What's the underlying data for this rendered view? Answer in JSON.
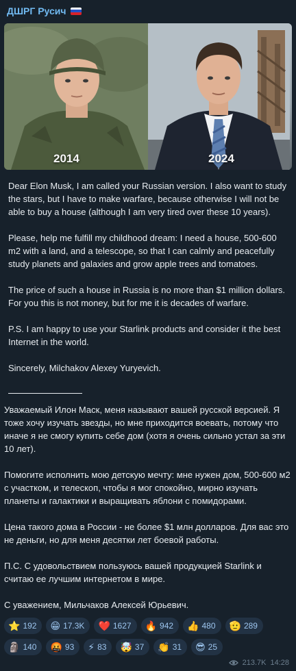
{
  "channel": {
    "name": "ДШРГ Русич"
  },
  "photo": {
    "year_left": "2014",
    "year_right": "2024"
  },
  "english": {
    "p1": "Dear Elon Musk, I am called your Russian version. I also want to study the stars, but I have to make warfare, because otherwise I will not be able to buy a house (although I am very tired over these 10 years).",
    "p2": "Please, help me fulfill my childhood dream: I need a house, 500-600 m2 with a land, and a telescope, so that I can calmly and peacefully study planets and galaxies and grow apple trees and tomatoes.",
    "p3": "The price of such a house in Russia is no more than $1 million dollars. For you this is not money, but for me it is decades of warfare.",
    "p4": "P.S. I am happy to use your Starlink products and consider it the best Internet in the world.",
    "p5": "Sincerely, Milchakov Alexey Yuryevich."
  },
  "russian": {
    "p1": "Уважаемый Илон Маск, меня называют вашей русской версией. Я тоже хочу изучать звезды, но мне приходится воевать, потому что иначе я не смогу купить себе дом (хотя я очень сильно устал за эти 10 лет).",
    "p2": "Помогите исполнить мою детскую мечту: мне нужен дом, 500-600 м2 с участком, и телескоп, чтобы я мог спокойно, мирно изучать планеты и галактики и выращивать яблони с помидорами.",
    "p3": "Цена такого дома в России - не более $1 млн долларов. Для вас это не деньги, но для меня десятки лет боевой работы.",
    "p4": "П.С. С удовольствием пользуюсь вашей продукцией Starlink и считаю ее лучшим интернетом в мире.",
    "p5": "С уважением, Мильчаков Алексей Юрьевич."
  },
  "reactions": [
    {
      "emoji": "⭐",
      "count": "192"
    },
    {
      "emoji": "😁",
      "count": "17.3K"
    },
    {
      "emoji": "❤️",
      "count": "1627"
    },
    {
      "emoji": "🔥",
      "count": "942"
    },
    {
      "emoji": "👍",
      "count": "480"
    },
    {
      "emoji": "🫡",
      "count": "289"
    },
    {
      "emoji": "🗿",
      "count": "140"
    },
    {
      "emoji": "🤬",
      "count": "93"
    },
    {
      "emoji": "⚡",
      "count": "83"
    },
    {
      "emoji": "🤯",
      "count": "37"
    },
    {
      "emoji": "👏",
      "count": "31"
    },
    {
      "emoji": "😎",
      "count": "25"
    }
  ],
  "footer": {
    "views": "213.7K",
    "time": "14:28"
  },
  "colors": {
    "background": "#17212b",
    "channel_name": "#71baf1",
    "reaction_bg": "#223244",
    "reaction_text": "#9ec6ef",
    "meta_text": "#6d7f8f"
  }
}
